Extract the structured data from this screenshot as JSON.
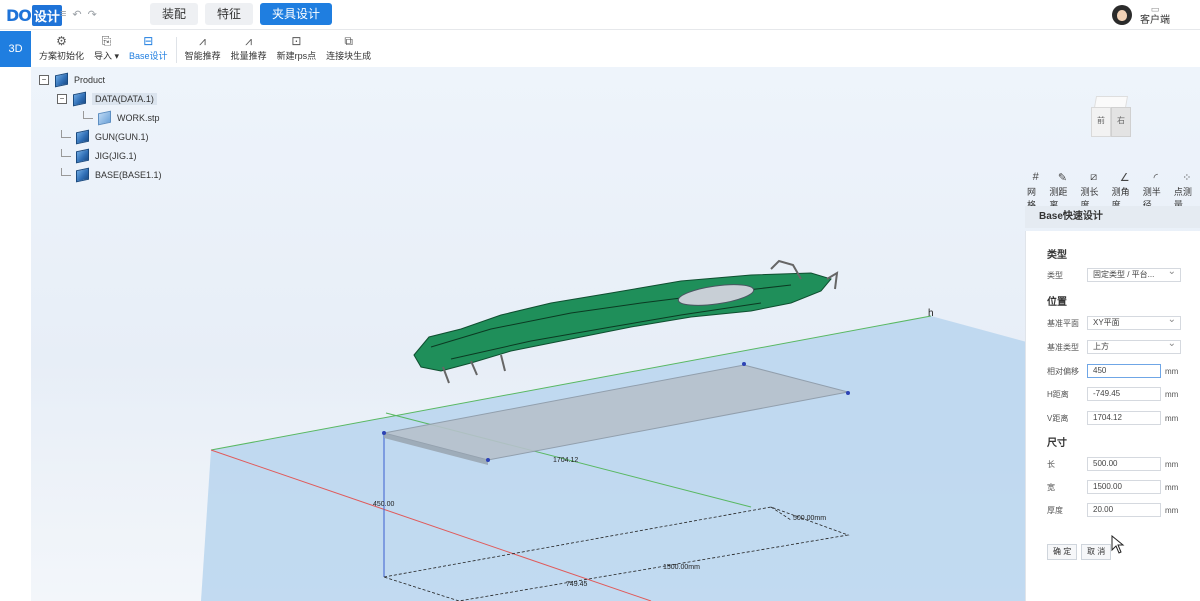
{
  "header": {
    "logo_mark": "DO",
    "logo_text": "设计",
    "tabs": [
      {
        "label": "装配",
        "active": false
      },
      {
        "label": "特征",
        "active": false
      },
      {
        "label": "夹具设计",
        "active": true
      }
    ],
    "user_label": "客户端"
  },
  "toolbar": {
    "mode": "3D",
    "tools": [
      {
        "label": "方案初始化",
        "icon": "gear-icon"
      },
      {
        "label": "导入 ▾",
        "icon": "import-icon"
      },
      {
        "label": "Base设计",
        "icon": "base-icon",
        "active": true
      },
      {
        "label": "智能推荐",
        "icon": "compass-icon"
      },
      {
        "label": "批量推荐",
        "icon": "compass-icon"
      },
      {
        "label": "新建rps点",
        "icon": "add-point-icon"
      },
      {
        "label": "连接块生成",
        "icon": "copy-icon"
      }
    ]
  },
  "tree": {
    "root": "Product",
    "data": "DATA(DATA.1)",
    "work": "WORK.stp",
    "gun": "GUN(GUN.1)",
    "jig": "JIG(JIG.1)",
    "base": "BASE(BASE1.1)"
  },
  "view_cube": {
    "left": "前",
    "right": "右"
  },
  "measure_tools": [
    "网格",
    "测距离",
    "测长度",
    "测角度",
    "测半径",
    "点测量"
  ],
  "panel": {
    "title": "Base快速设计",
    "section_type": "类型",
    "type_label": "类型",
    "type_value": "固定类型 / 平台...",
    "section_position": "位置",
    "ref_plane_label": "基准平面",
    "ref_plane_value": "XY平面",
    "ref_type_label": "基准类型",
    "ref_type_value": "上方",
    "offset_label": "相对偏移",
    "offset_value": "450",
    "h_dist_label": "H距离",
    "h_dist_value": "-749.45",
    "v_dist_label": "V距离",
    "v_dist_value": "1704.12",
    "section_size": "尺寸",
    "length_label": "长",
    "length_value": "500.00",
    "width_label": "宽",
    "width_value": "1500.00",
    "thickness_label": "厚度",
    "thickness_value": "20.00",
    "unit": "mm",
    "ok": "确 定",
    "cancel": "取 消"
  },
  "viewport": {
    "axis_h_label": "h",
    "dim_1704": "1704.12",
    "dim_450": "450.00",
    "dim_500": "500.00mm",
    "dim_1500": "1500.00mm",
    "dim_749": "749.45"
  },
  "colors": {
    "accent": "#1f7ee0",
    "plane": "#b9d5ee",
    "part": "#1f8f5a"
  }
}
